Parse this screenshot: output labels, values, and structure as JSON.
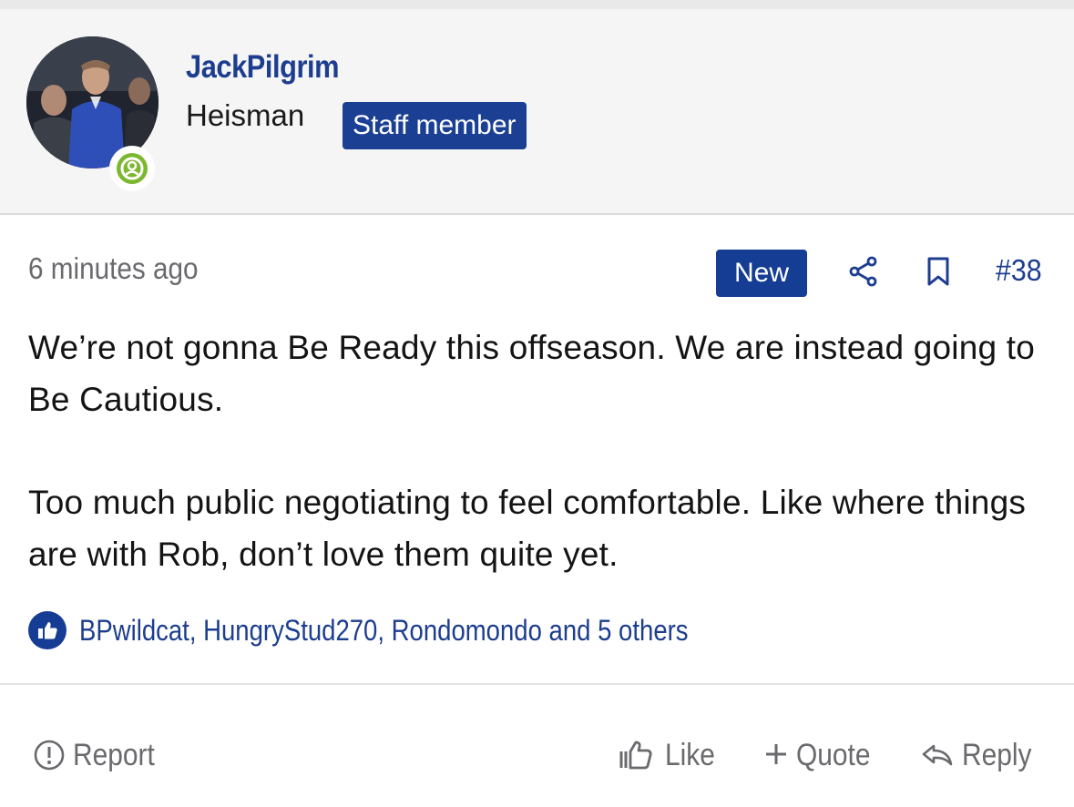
{
  "post": {
    "author": {
      "username": "JackPilgrim",
      "user_title": "Heisman",
      "staff_badge": "Staff member",
      "avatar_icon": "user-avatar",
      "status_icon": "online-user-icon",
      "status_color": "#7cb82f"
    },
    "meta": {
      "timestamp": "6 minutes ago",
      "new_badge": "New",
      "post_number": "#38"
    },
    "body": {
      "paragraphs": [
        "We’re not gonna Be Ready this offseason. We are instead going to Be Cautious.",
        "Too much public negotiating to feel comfortable. Like where things are with Rob, don’t love them quite yet."
      ]
    },
    "reactions": {
      "text": "BPwildcat, HungryStud270, Rondomondo and 5 others",
      "icon": "thumbs-up-icon"
    },
    "actions": {
      "report": "Report",
      "like": "Like",
      "quote": "Quote",
      "reply": "Reply"
    }
  },
  "colors": {
    "link_blue": "#1d3d8f",
    "badge_blue": "#163d94",
    "muted_gray": "#6a6a6e",
    "header_bg": "#f5f5f6"
  }
}
